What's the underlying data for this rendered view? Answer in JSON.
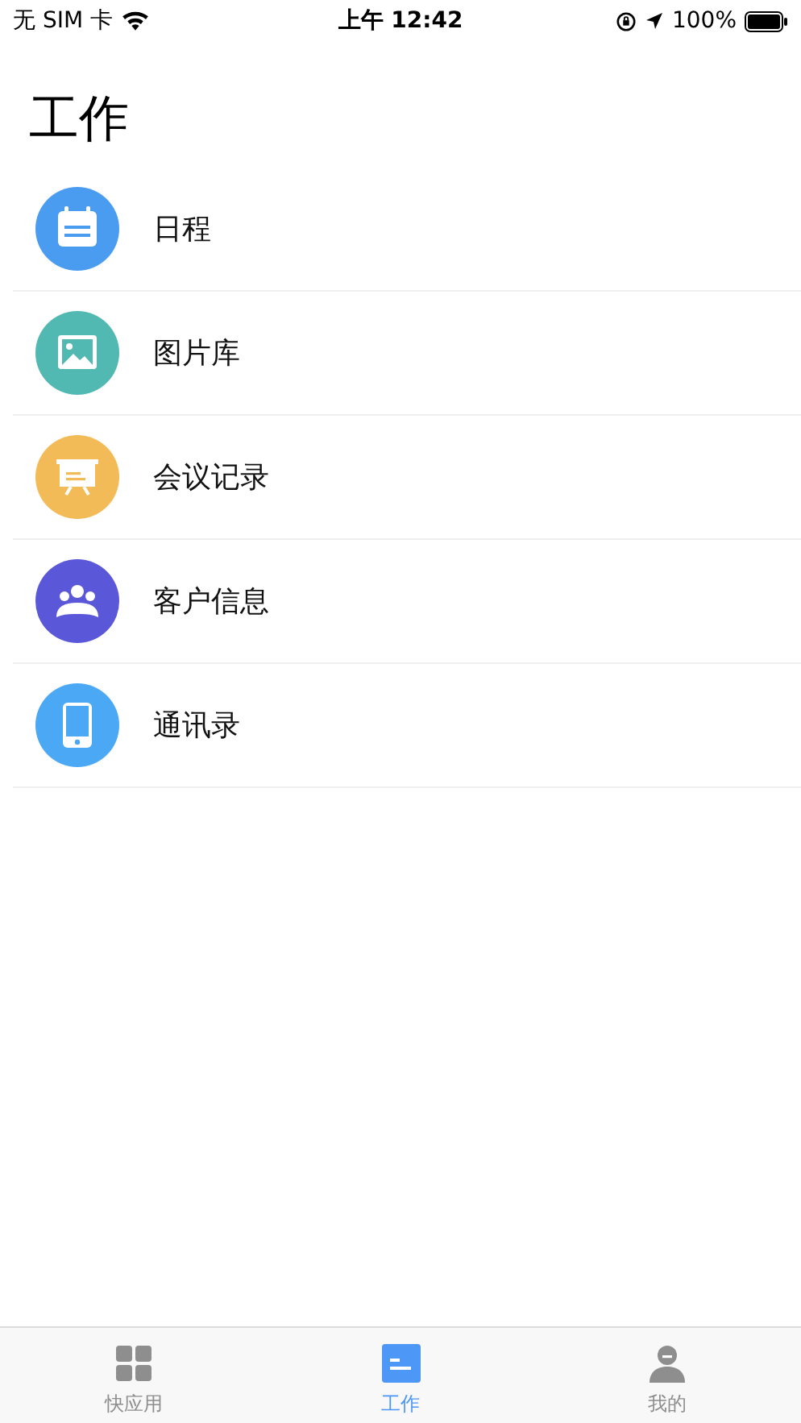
{
  "status_bar": {
    "carrier": "无 SIM 卡",
    "time": "上午 12:42",
    "battery": "100%"
  },
  "title": "工作",
  "items": [
    {
      "label": "日程",
      "kind": "calendar",
      "color": "#4a9cf0"
    },
    {
      "label": "图片库",
      "kind": "image",
      "color": "#52b8b2"
    },
    {
      "label": "会议记录",
      "kind": "board",
      "color": "#f2bb57"
    },
    {
      "label": "客户信息",
      "kind": "people",
      "color": "#5a57d8"
    },
    {
      "label": "通讯录",
      "kind": "phone",
      "color": "#4aa8f4"
    }
  ],
  "tabs": [
    {
      "label": "快应用",
      "kind": "grid",
      "selected": false
    },
    {
      "label": "工作",
      "kind": "work",
      "selected": true
    },
    {
      "label": "我的",
      "kind": "person",
      "selected": false
    }
  ]
}
